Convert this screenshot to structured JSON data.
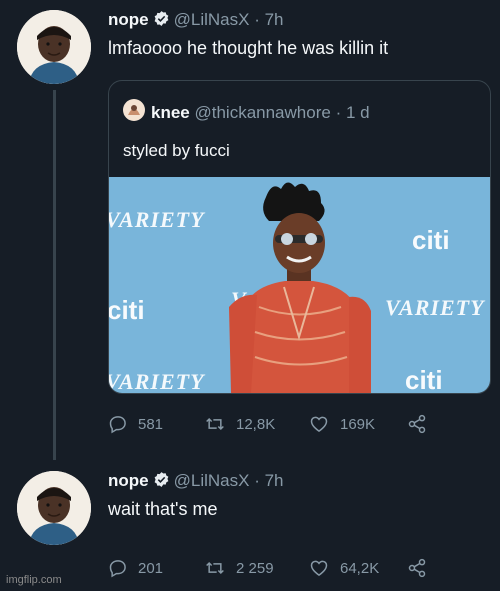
{
  "tweet1": {
    "name": "nope",
    "handle": "@LilNasX",
    "time": "· 7h",
    "text": "lmfaoooo he thought he was killin it"
  },
  "quote": {
    "name": "knee",
    "handle": "@thickannawhore",
    "time": "· 1 d",
    "text": "styled by fucci",
    "backdrop_brands": [
      "VARIETY",
      "citi",
      "citi",
      "VARIETY",
      "VARIETY",
      "citi",
      "V"
    ]
  },
  "tweet1_actions": {
    "replies": "581",
    "retweets": "12,8K",
    "likes": "169K"
  },
  "tweet2": {
    "name": "nope",
    "handle": "@LilNasX",
    "time": "· 7h",
    "text": "wait that's me"
  },
  "tweet2_actions": {
    "replies": "201",
    "retweets": "2 259",
    "likes": "64,2K"
  },
  "watermark": "imgflip.com",
  "colors": {
    "background": "#161d26",
    "muted": "#8899a6",
    "verified": "#e7ecf0",
    "backdrop": "#79b5da"
  }
}
